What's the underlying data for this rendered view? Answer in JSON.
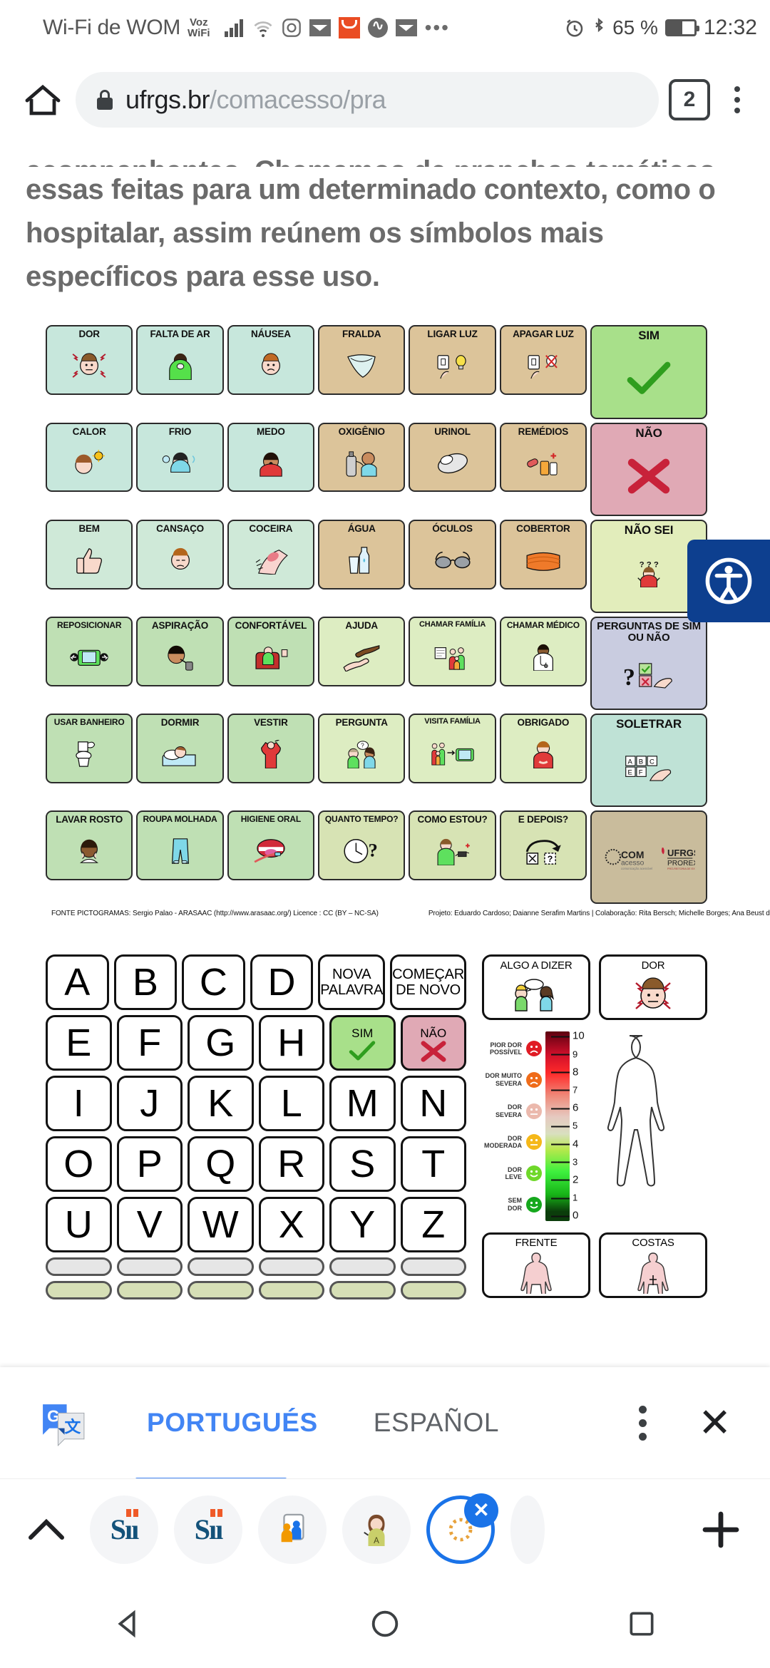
{
  "statusbar": {
    "carrier": "Wi-Fi de WOM",
    "voz_line1": "Voz",
    "voz_line2": "WiFi",
    "icons": [
      "signal-bars-icon",
      "wifi-icon",
      "instagram-icon",
      "gmail-icon",
      "aliexpress-icon",
      "messenger-icon",
      "gmail-icon",
      "more-notifications-icon",
      "alarm-icon",
      "bluetooth-icon"
    ],
    "battery_percent": "65 %",
    "time": "12:32"
  },
  "browser": {
    "home_icon": "home-icon",
    "lock_icon": "lock-icon",
    "url_host": "ufrgs.br",
    "url_path": "/comacesso/pra",
    "tab_count": "2",
    "menu_icon": "kebab-menu-icon"
  },
  "page": {
    "paragraph": [
      "acompanhantes. Chamamos de pranchas temáticas",
      "essas feitas para um determinado contexto, como o",
      "hospitalar, assim reúnem os símbolos mais",
      "específicos para esse uso."
    ],
    "accessibility_button": "accessibility-icon"
  },
  "board": {
    "rows": [
      [
        {
          "label": "DOR",
          "color": "teal",
          "art": "face-pain"
        },
        {
          "label": "FALTA DE AR",
          "color": "teal",
          "art": "breathless"
        },
        {
          "label": "NÁUSEA",
          "color": "teal",
          "art": "face-nausea"
        },
        {
          "label": "FRALDA",
          "color": "tan",
          "art": "diaper"
        },
        {
          "label": "LIGAR LUZ",
          "color": "tan",
          "art": "light-on"
        },
        {
          "label": "APAGAR LUZ",
          "color": "tan",
          "art": "light-off"
        },
        {
          "label": "SIM",
          "color": "yesgrn",
          "art": "check"
        }
      ],
      [
        {
          "label": "CALOR",
          "color": "teal",
          "art": "hot"
        },
        {
          "label": "FRIO",
          "color": "teal",
          "art": "cold"
        },
        {
          "label": "MEDO",
          "color": "teal",
          "art": "fear"
        },
        {
          "label": "OXIGÊNIO",
          "color": "tan",
          "art": "oxygen"
        },
        {
          "label": "URINOL",
          "color": "tan",
          "art": "urinal"
        },
        {
          "label": "REMÉDIOS",
          "color": "tan",
          "art": "medicine"
        },
        {
          "label": "NÃO",
          "color": "nored",
          "art": "cross"
        }
      ],
      [
        {
          "label": "BEM",
          "color": "mint",
          "art": "thumb-up"
        },
        {
          "label": "CANSAÇO",
          "color": "mint",
          "art": "tired"
        },
        {
          "label": "COCEIRA",
          "color": "mint",
          "art": "itch"
        },
        {
          "label": "ÁGUA",
          "color": "tan",
          "art": "water"
        },
        {
          "label": "ÓCULOS",
          "color": "tan",
          "art": "glasses"
        },
        {
          "label": "COBERTOR",
          "color": "tan",
          "art": "blanket"
        },
        {
          "label": "NÃO SEI",
          "color": "nosei",
          "art": "shrug"
        }
      ],
      [
        {
          "label": "REPOSICIONAR",
          "color": "grn",
          "art": "reposition"
        },
        {
          "label": "ASPIRAÇÃO",
          "color": "grn",
          "art": "suction"
        },
        {
          "label": "CONFORTÁVEL",
          "color": "grn",
          "art": "comfortable"
        },
        {
          "label": "AJUDA",
          "color": "ltgrn",
          "art": "help-hands"
        },
        {
          "label": "CHAMAR FAMÍLIA",
          "color": "ltgrn",
          "art": "call-family"
        },
        {
          "label": "CHAMAR MÉDICO",
          "color": "ltgrn",
          "art": "call-doctor"
        },
        {
          "label": "PERGUNTAS DE SIM OU NÃO",
          "color": "lilac",
          "art": "yes-no-questions"
        }
      ],
      [
        {
          "label": "USAR BANHEIRO",
          "color": "grn",
          "art": "toilet"
        },
        {
          "label": "DORMIR",
          "color": "grn",
          "art": "sleep"
        },
        {
          "label": "VESTIR",
          "color": "grn",
          "art": "dress"
        },
        {
          "label": "PERGUNTA",
          "color": "ltgrn",
          "art": "question-talk"
        },
        {
          "label": "VISITA FAMÍLIA",
          "color": "ltgrn",
          "art": "family-visit"
        },
        {
          "label": "OBRIGADO",
          "color": "ltgrn",
          "art": "thanks"
        },
        {
          "label": "SOLETRAR",
          "color": "spell",
          "art": "spell-abc"
        }
      ],
      [
        {
          "label": "LAVAR ROSTO",
          "color": "grn",
          "art": "wash-face"
        },
        {
          "label": "ROUPA MOLHADA",
          "color": "grn",
          "art": "wet-clothes"
        },
        {
          "label": "HIGIENE ORAL",
          "color": "grn",
          "art": "oral-hygiene"
        },
        {
          "label": "QUANTO TEMPO?",
          "color": "olive",
          "art": "clock-question"
        },
        {
          "label": "COMO ESTOU?",
          "color": "olive",
          "art": "how-am-i"
        },
        {
          "label": "E DEPOIS?",
          "color": "olive",
          "art": "what-next"
        },
        {
          "label": "",
          "color": "logo",
          "art": "comacesso-ufrgs-logo"
        }
      ]
    ],
    "credit_source": "FONTE PICTOGRAMAS: Sergio Palao - ARASAAC (http://www.arasaac.org/) Licence : CC (BY – NC-SA)",
    "credit_project": "Projeto: Eduardo Cardoso; Daianne Serafim Martins | Colaboração: Rita Bersch; Michelle Borges; Ana Beust da Silva"
  },
  "alphabet": {
    "rows": [
      [
        "A",
        "B",
        "C",
        "D"
      ],
      [
        "E",
        "F",
        "G",
        "H"
      ],
      [
        "I",
        "J",
        "K",
        "L",
        "M",
        "N"
      ],
      [
        "O",
        "P",
        "Q",
        "R",
        "S",
        "T"
      ],
      [
        "U",
        "V",
        "W",
        "X",
        "Y",
        "Z"
      ]
    ],
    "nova_palavra_line1": "NOVA",
    "nova_palavra_line2": "PALAVRA",
    "comecar_line1": "COMEÇAR",
    "comecar_line2": "DE NOVO",
    "sim": "SIM",
    "nao": "NÃO"
  },
  "right_panel": {
    "algo_a_dizer": "ALGO A DIZER",
    "dor": "DOR",
    "frente": "FRENTE",
    "costas": "COSTAS",
    "pain_scale": {
      "levels": [
        {
          "text1": "PIOR DOR",
          "text2": "POSSÍVEL",
          "value": "10",
          "face_color": "#e01b24"
        },
        {
          "text1": "",
          "text2": "",
          "value": "9",
          "face_color": ""
        },
        {
          "text1": "DOR MUITO",
          "text2": "SEVERA",
          "value": "8",
          "face_color": "#ef6c1a"
        },
        {
          "text1": "",
          "text2": "",
          "value": "7",
          "face_color": ""
        },
        {
          "text1": "DOR",
          "text2": "SEVERA",
          "value": "6",
          "face_color": "#ebb9ad"
        },
        {
          "text1": "",
          "text2": "",
          "value": "5",
          "face_color": ""
        },
        {
          "text1": "DOR",
          "text2": "MODERADA",
          "value": "4",
          "face_color": "#f5b819"
        },
        {
          "text1": "",
          "text2": "",
          "value": "3",
          "face_color": ""
        },
        {
          "text1": "DOR",
          "text2": "LEVE",
          "value": "2",
          "face_color": "#6fd82a"
        },
        {
          "text1": "",
          "text2": "",
          "value": "1",
          "face_color": ""
        },
        {
          "text1": "SEM",
          "text2": "DOR",
          "value": "0",
          "face_color": "#16a81d"
        }
      ]
    }
  },
  "translate_bar": {
    "logo": "google-translate-icon",
    "tab_active": "PORTUGUÉS",
    "tab_other": "ESPAÑOL",
    "menu_icon": "kebab-menu-icon",
    "close_icon": "close-icon",
    "accent": "#4285f4"
  },
  "dock": {
    "expand_icon": "chevron-up-icon",
    "items": [
      {
        "name": "sii-app",
        "label": "Sii"
      },
      {
        "name": "sii-app",
        "label": "Sii"
      },
      {
        "name": "presentation-app",
        "label": ""
      },
      {
        "name": "avatar-app",
        "label": ""
      },
      {
        "name": "loading-tab",
        "label": ""
      },
      {
        "name": "partial-tab",
        "label": ""
      }
    ],
    "selected_index": 4,
    "close_badge": "close-icon",
    "add_icon": "plus-icon"
  },
  "navbar": {
    "back": "back-triangle-icon",
    "home": "home-circle-icon",
    "recents": "recents-square-icon"
  }
}
